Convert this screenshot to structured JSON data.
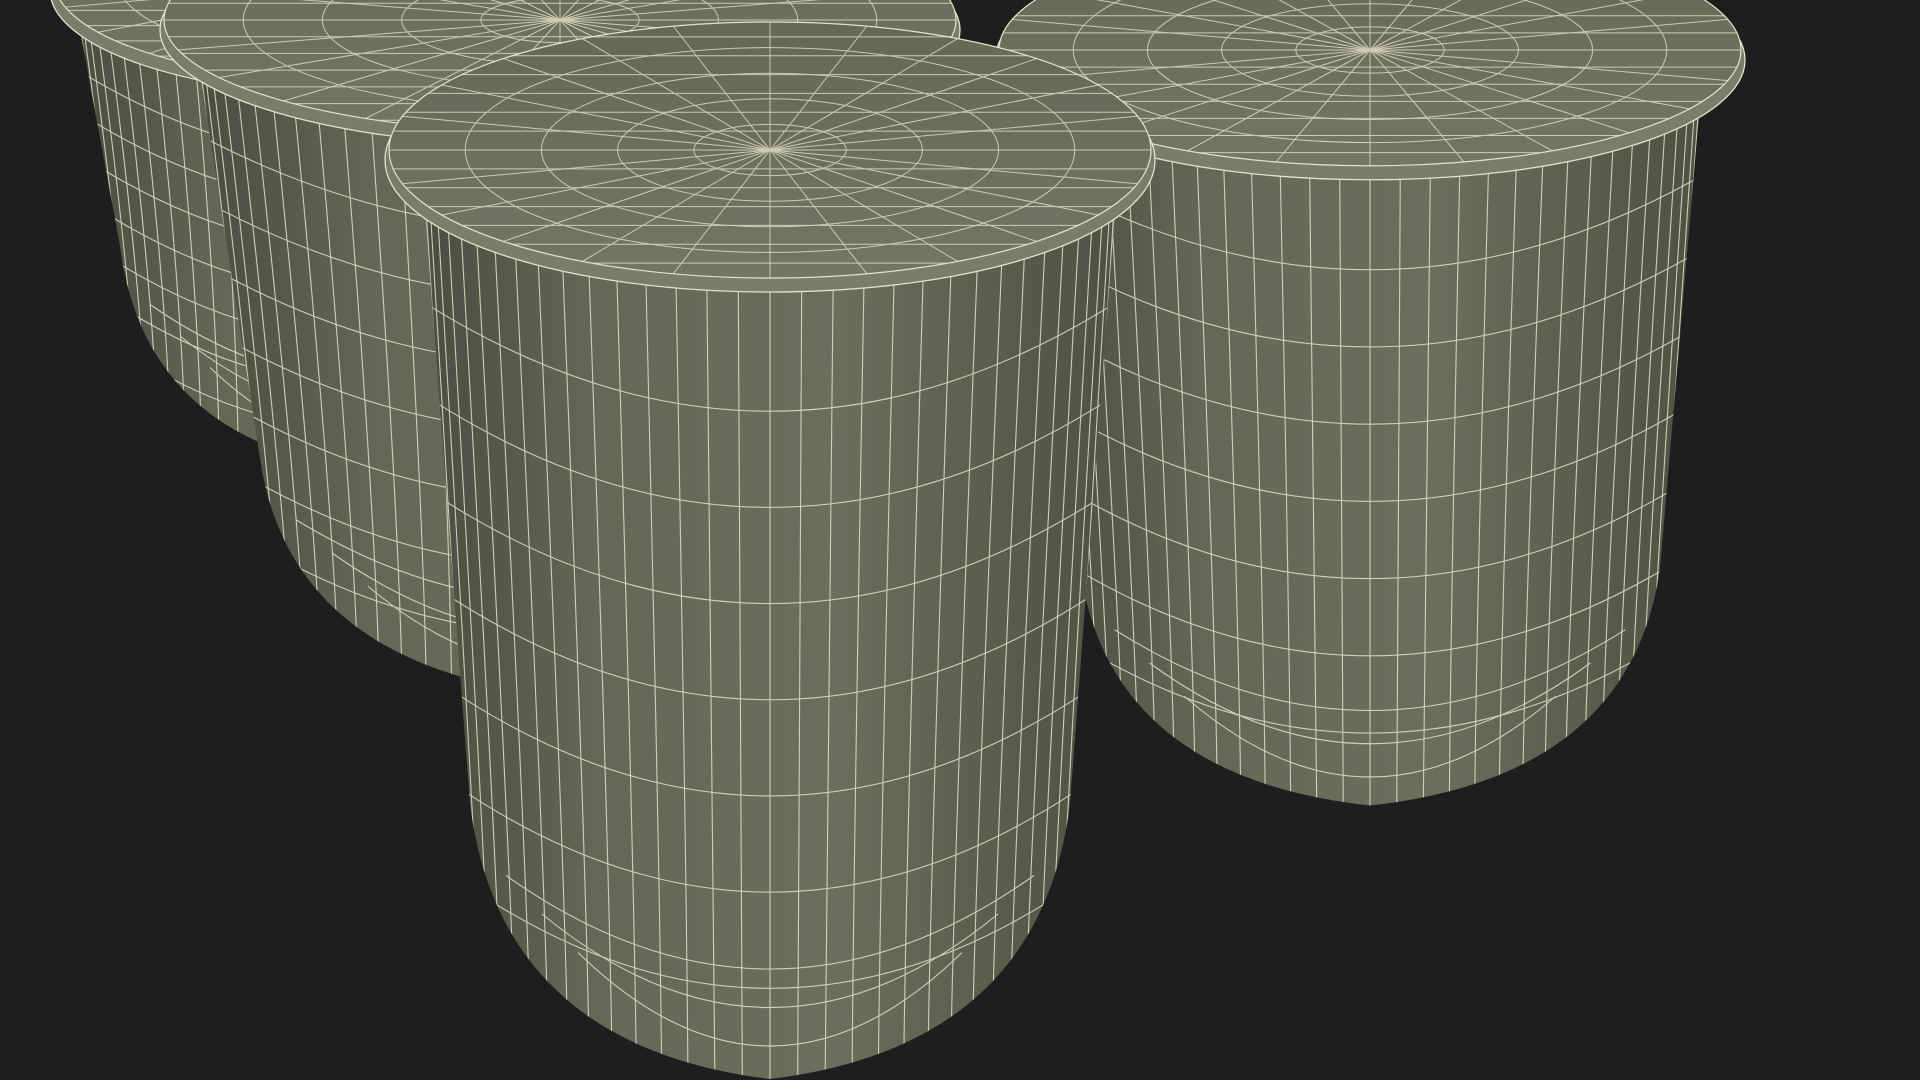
{
  "scene": {
    "background_color": "#1e1e1e",
    "body_color": "#686b58",
    "body_shade_color": "#4d5042",
    "lid_color": "#6f725f",
    "lid_rim_color": "#7a7d69",
    "wire_color": "#e6e2c8",
    "objects": [
      "back-left-cup",
      "back-middle-cup",
      "right-cup",
      "front-cup"
    ]
  }
}
